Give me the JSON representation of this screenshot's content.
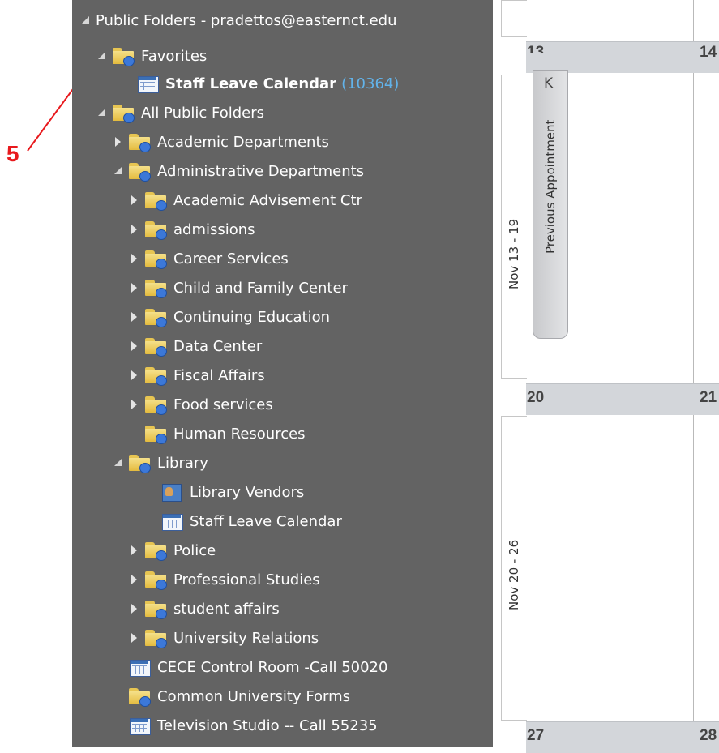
{
  "annotation": {
    "number": "5",
    "color": "#e8191d"
  },
  "folders": {
    "header": "Public Folders - pradettos@easternct.edu",
    "items": [
      {
        "label": "Favorites",
        "count": "",
        "icon": "folder-icon",
        "toggle": "expanded",
        "bold": false
      },
      {
        "label": "Staff Leave Calendar",
        "count": "(10364)",
        "icon": "calendar-icon",
        "toggle": "none",
        "bold": true
      },
      {
        "label": "All Public Folders",
        "count": "",
        "icon": "folder-icon",
        "toggle": "expanded",
        "bold": false
      },
      {
        "label": "Academic Departments",
        "count": "",
        "icon": "folder-icon",
        "toggle": "collapsed",
        "bold": false
      },
      {
        "label": "Administrative Departments",
        "count": "",
        "icon": "folder-icon",
        "toggle": "expanded",
        "bold": false
      },
      {
        "label": "Academic Advisement Ctr",
        "count": "",
        "icon": "folder-icon",
        "toggle": "collapsed",
        "bold": false
      },
      {
        "label": "admissions",
        "count": "",
        "icon": "folder-icon",
        "toggle": "collapsed",
        "bold": false
      },
      {
        "label": "Career Services",
        "count": "",
        "icon": "folder-icon",
        "toggle": "collapsed",
        "bold": false
      },
      {
        "label": "Child and Family Center",
        "count": "",
        "icon": "folder-icon",
        "toggle": "collapsed",
        "bold": false
      },
      {
        "label": "Continuing Education",
        "count": "",
        "icon": "folder-icon",
        "toggle": "collapsed",
        "bold": false
      },
      {
        "label": "Data Center",
        "count": "",
        "icon": "folder-icon",
        "toggle": "collapsed",
        "bold": false
      },
      {
        "label": "Fiscal Affairs",
        "count": "",
        "icon": "folder-icon",
        "toggle": "collapsed",
        "bold": false
      },
      {
        "label": "Food services",
        "count": "",
        "icon": "folder-icon",
        "toggle": "collapsed",
        "bold": false
      },
      {
        "label": "Human Resources",
        "count": "",
        "icon": "folder-icon",
        "toggle": "none",
        "bold": false
      },
      {
        "label": "Library",
        "count": "",
        "icon": "folder-icon",
        "toggle": "expanded",
        "bold": false
      },
      {
        "label": "Library Vendors",
        "count": "",
        "icon": "contacts-icon",
        "toggle": "none",
        "bold": false
      },
      {
        "label": "Staff Leave Calendar",
        "count": "",
        "icon": "calendar-icon",
        "toggle": "none",
        "bold": false
      },
      {
        "label": "Police",
        "count": "",
        "icon": "folder-icon",
        "toggle": "collapsed",
        "bold": false
      },
      {
        "label": "Professional Studies",
        "count": "",
        "icon": "folder-icon",
        "toggle": "collapsed",
        "bold": false
      },
      {
        "label": "student affairs",
        "count": "",
        "icon": "folder-icon",
        "toggle": "collapsed",
        "bold": false
      },
      {
        "label": "University Relations",
        "count": "",
        "icon": "folder-icon",
        "toggle": "collapsed",
        "bold": false
      },
      {
        "label": "CECE Control Room -Call 50020",
        "count": "",
        "icon": "calendar-icon",
        "toggle": "none",
        "bold": false
      },
      {
        "label": "Common University Forms",
        "count": "",
        "icon": "folder-icon",
        "toggle": "none",
        "bold": false
      },
      {
        "label": "Television Studio -- Call 55235",
        "count": "",
        "icon": "calendar-icon",
        "toggle": "none",
        "bold": false
      }
    ]
  },
  "calendar": {
    "day_13": "13",
    "day_14": "14",
    "day_20": "20",
    "day_21": "21",
    "day_27": "27",
    "day_28": "28",
    "week1": "Nov 13 - 19",
    "week2": "Nov 20 - 26",
    "previous_appointment": "Previous Appointment",
    "previous_icon": "skip-back-icon"
  },
  "colors": {
    "pane_bg": "#636363",
    "count_color": "#62b3ea",
    "header_band": "#d3d6da"
  }
}
